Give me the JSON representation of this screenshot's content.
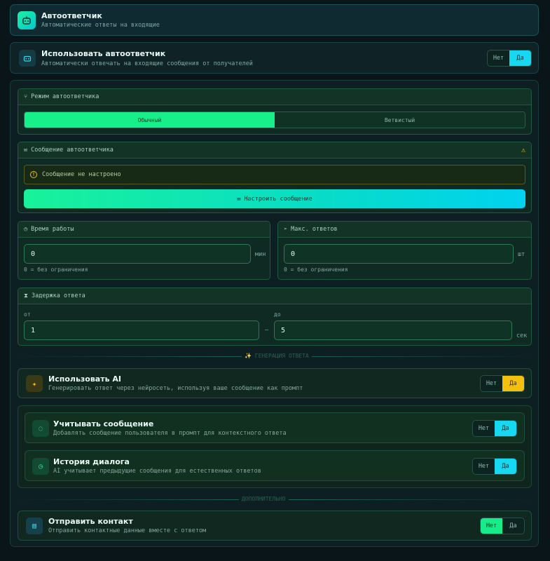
{
  "header": {
    "title": "Автоответчик",
    "subtitle": "Автоматические ответы на входящие"
  },
  "use_autoresponder": {
    "title": "Использовать автоответчик",
    "subtitle": "Автоматически отвечать на входящие сообщения от получателей",
    "no": "Нет",
    "yes": "Да",
    "value": "Да"
  },
  "mode": {
    "title": "Режим автоответчика",
    "options": [
      "Обычный",
      "Ветвистый"
    ],
    "selected": "Обычный"
  },
  "message": {
    "title": "Сообщение автоответчика",
    "warning_text": "Сообщение не настроено",
    "button": "Настроить сообщение"
  },
  "work_time": {
    "title": "Время работы",
    "value": "0",
    "unit": "мин",
    "hint": "0 = без ограничения"
  },
  "max_replies": {
    "title": "Макс. ответов",
    "value": "0",
    "unit": "шт",
    "hint": "0 = без ограничения"
  },
  "delay": {
    "title": "Задержка ответа",
    "from_label": "от",
    "from_value": "1",
    "separator": "–",
    "to_label": "до",
    "to_value": "5",
    "unit": "сек"
  },
  "divider_ai": "✨ ГЕНЕРАЦИЯ ОТВЕТА",
  "use_ai": {
    "title": "Использовать AI",
    "subtitle": "Генерировать ответ через нейросеть, используя ваше сообщение как промпт",
    "no": "Нет",
    "yes": "Да",
    "value": "Да"
  },
  "consider_message": {
    "title": "Учитывать сообщение",
    "subtitle": "Добавлять сообщение пользователя в промпт для контекстного ответа",
    "no": "Нет",
    "yes": "Да",
    "value": "Да"
  },
  "dialog_history": {
    "title": "История диалога",
    "subtitle": "AI учитывает предыдущие сообщения для естественных ответов",
    "no": "Нет",
    "yes": "Да",
    "value": "Да"
  },
  "divider_extra": "ДОПОЛНИТЕЛЬНО",
  "send_contact": {
    "title": "Отправить контакт",
    "subtitle": "Отправить контактные данные вместе с ответом",
    "no": "Нет",
    "yes": "Да",
    "value": "Нет"
  },
  "colors": {
    "accent_green": "#17ec8a",
    "accent_cyan": "#16d8f0",
    "accent_yellow": "#f3c00d",
    "background": "#0a1519"
  }
}
